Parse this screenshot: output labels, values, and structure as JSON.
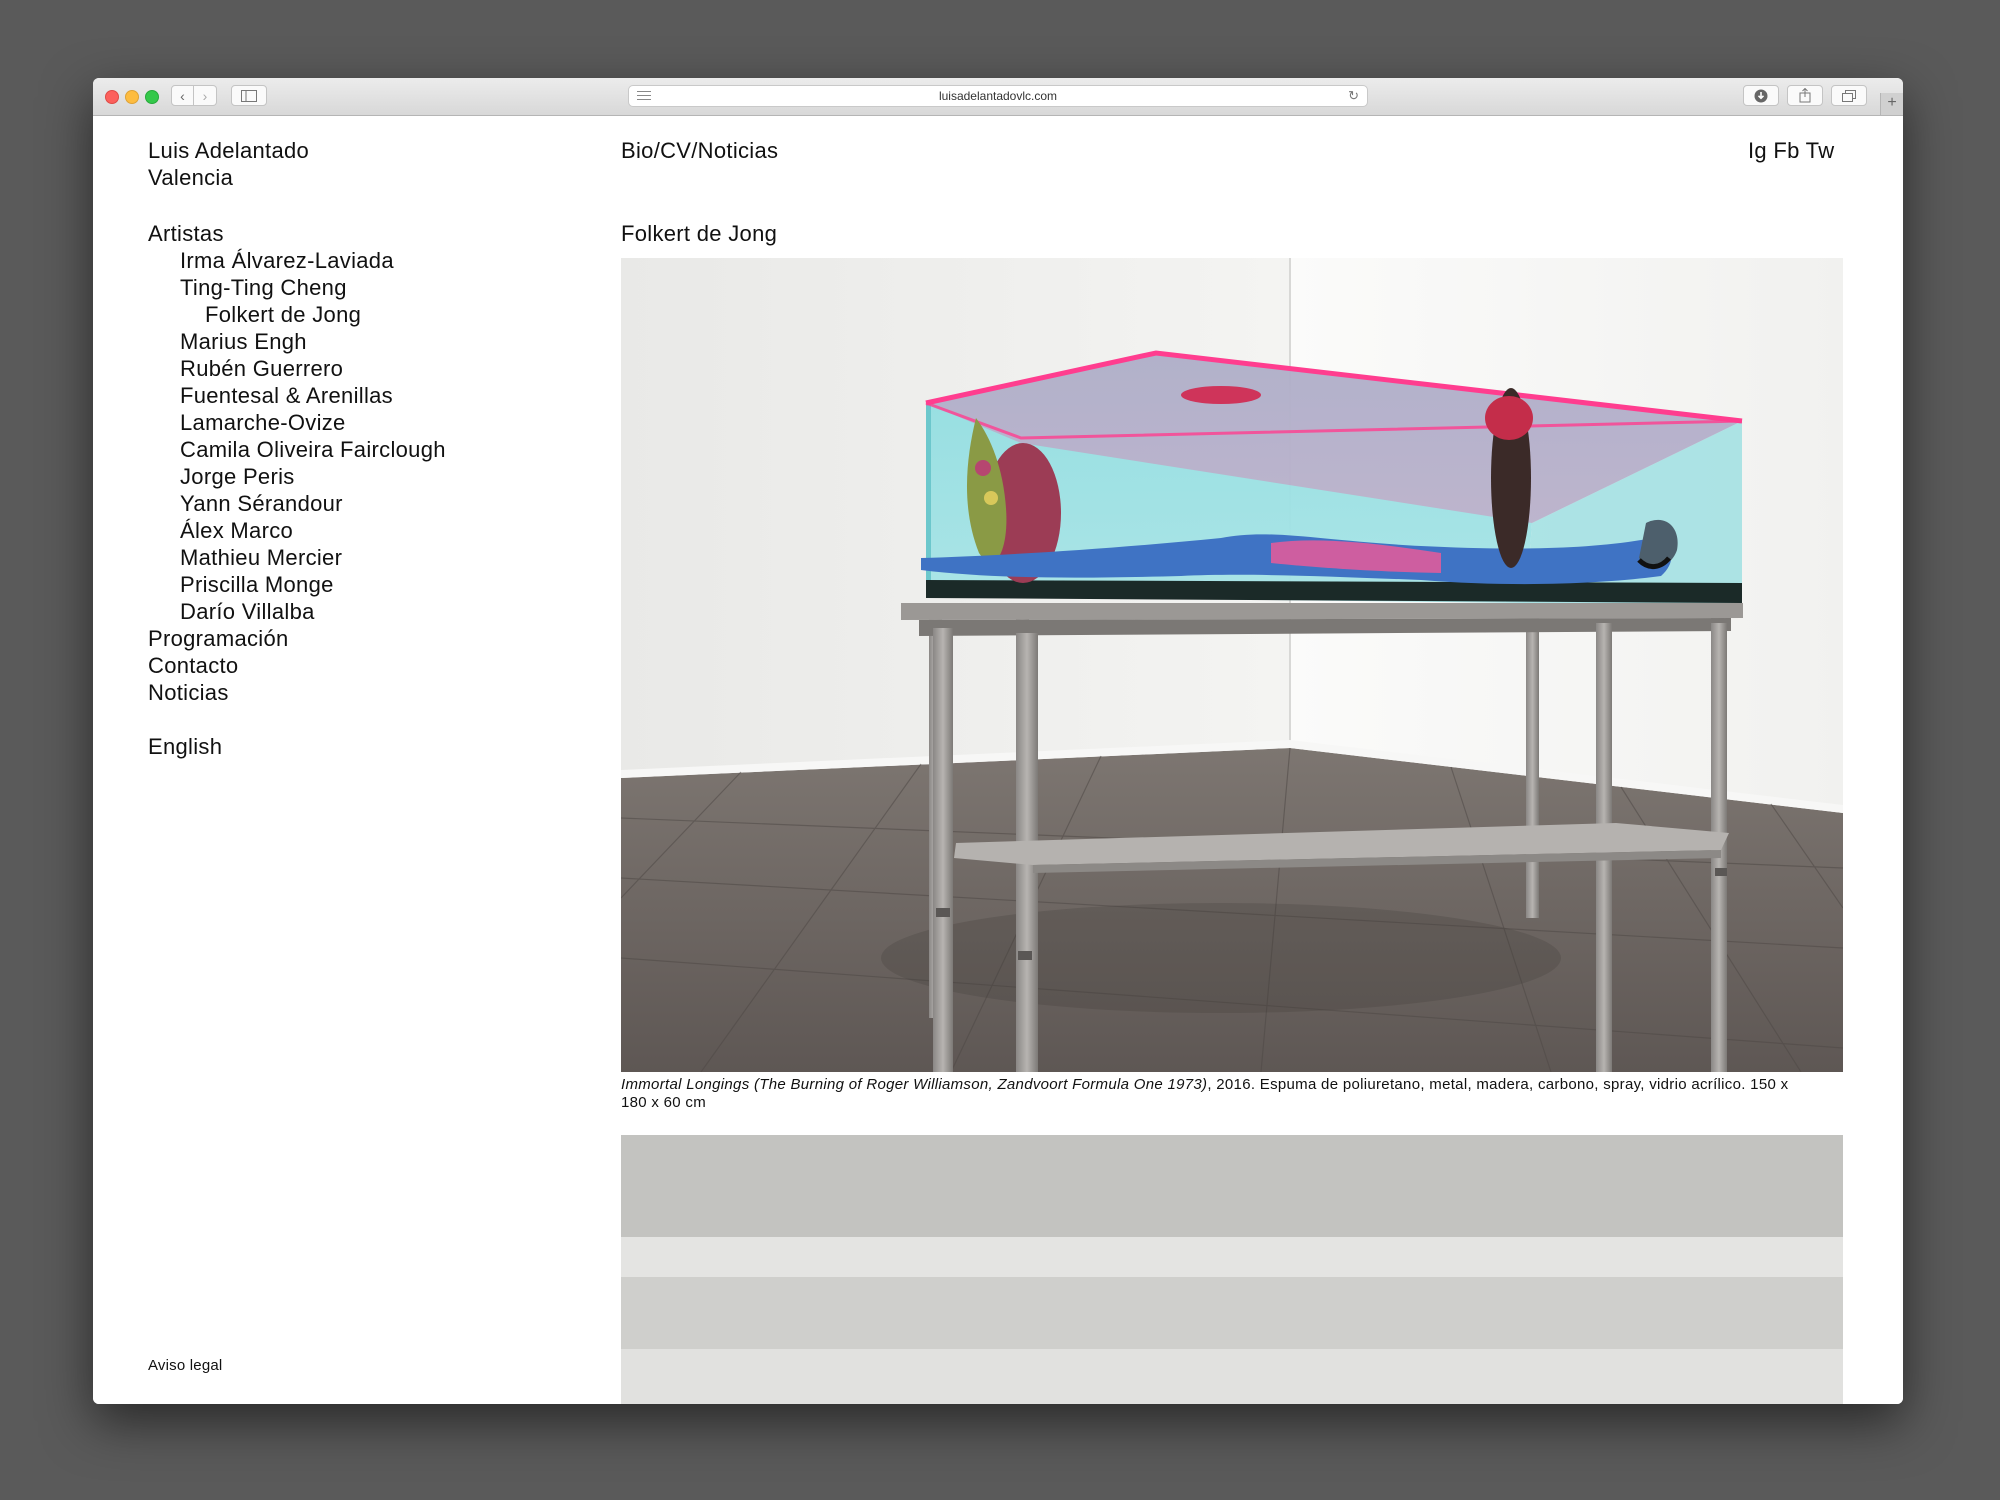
{
  "browser": {
    "url": "luisadelantadovlc.com"
  },
  "site": {
    "name": "Luis Adelantado",
    "city": "Valencia",
    "top_nav": "Bio/CV/Noticias",
    "social": {
      "ig": "Ig",
      "fb": "Fb",
      "tw": "Tw"
    }
  },
  "menu": {
    "artistas": "Artistas",
    "artists": [
      "Irma Álvarez-Laviada",
      "Ting-Ting Cheng",
      "Folkert de Jong",
      "Marius Engh",
      "Rubén Guerrero",
      "Fuentesal & Arenillas",
      "Lamarche-Ovize",
      "Camila Oliveira Fairclough",
      "Jorge Peris",
      "Yann Sérandour",
      "Álex Marco",
      "Mathieu Mercier",
      "Priscilla Monge",
      "Darío Villalba"
    ],
    "programacion": "Programación",
    "contacto": "Contacto",
    "noticias": "Noticias",
    "language": "English",
    "legal": "Aviso legal"
  },
  "content": {
    "artist_title": "Folkert de Jong",
    "caption_title": "Immortal Longings (The Burning of Roger Williamson, Zandvoort Formula One 1973)",
    "caption_text": ", 2016. Espuma de poliuretano, metal, madera, carbono, spray, vidrio acrílico. 150 x 180 x 60 cm"
  },
  "colors": {
    "desktop": "#5a5a5a",
    "text": "#111111",
    "tank_glass": "#8fdde0",
    "tank_lid": "#ff3d8f"
  }
}
